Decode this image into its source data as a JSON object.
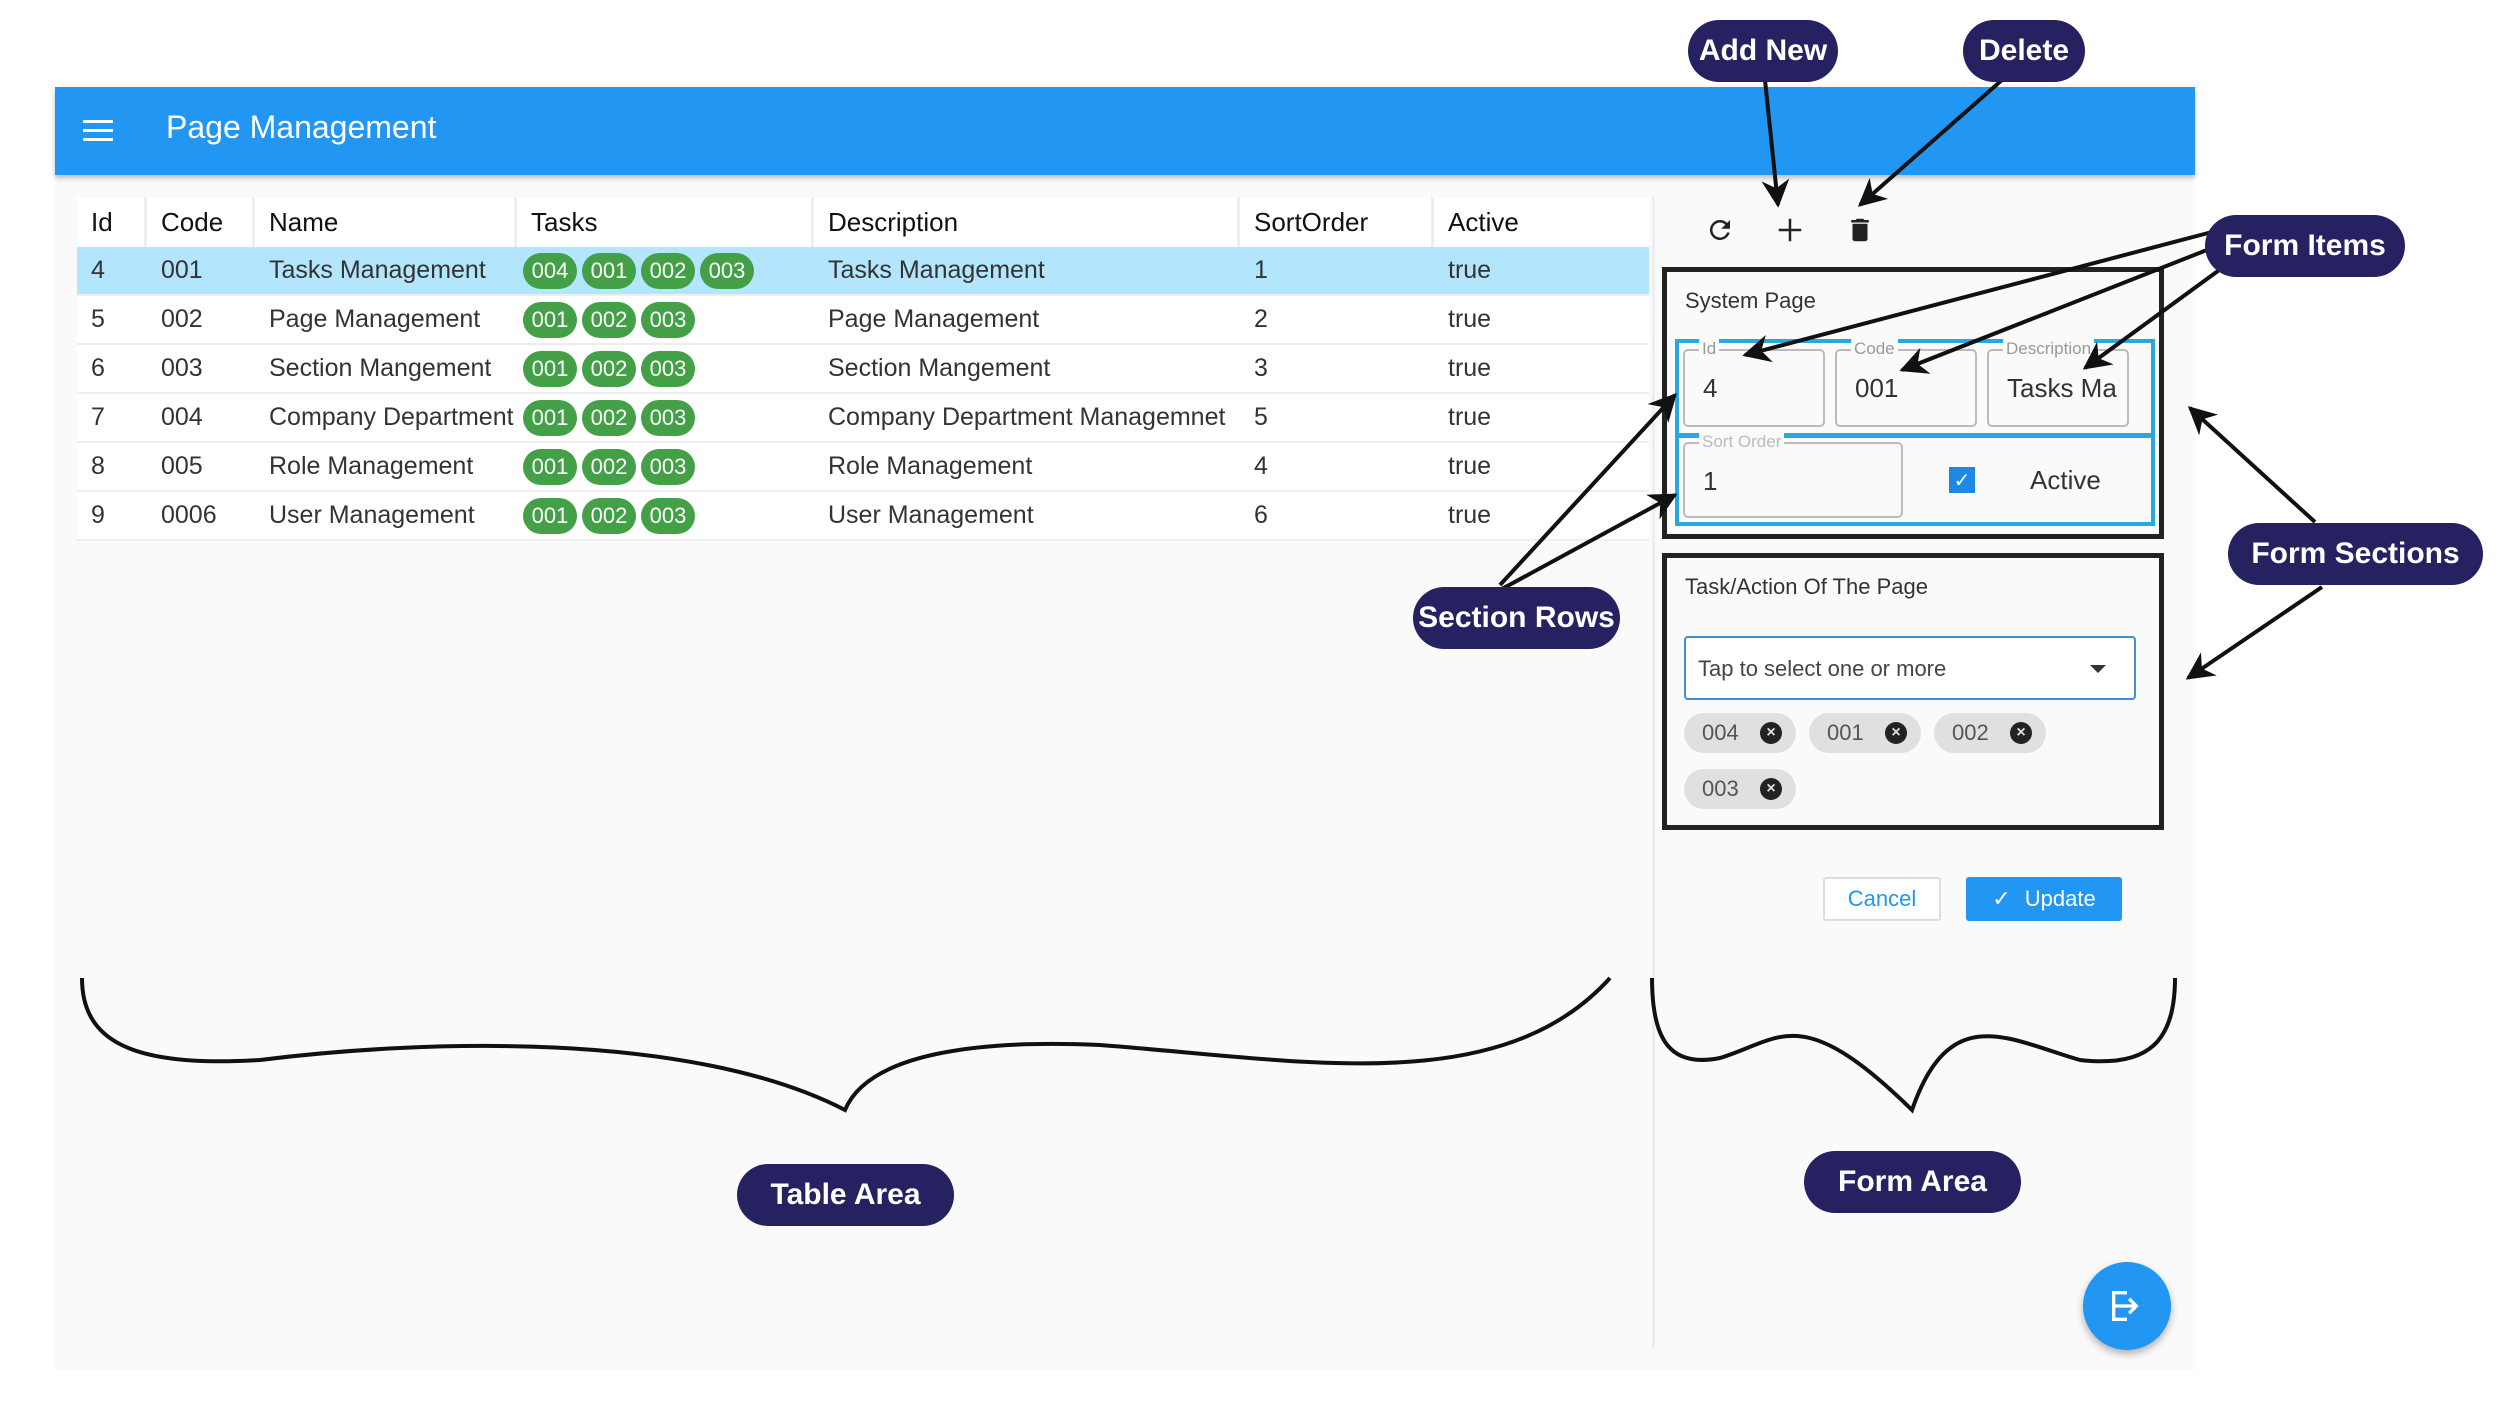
{
  "appbar": {
    "title": "Page Management",
    "menu_icon": "menu-icon"
  },
  "table": {
    "columns": [
      "Id",
      "Code",
      "Name",
      "Tasks",
      "Description",
      "SortOrder",
      "Active"
    ],
    "rows": [
      {
        "id": "4",
        "code": "001",
        "name": "Tasks Management",
        "tasks": [
          "004",
          "001",
          "002",
          "003"
        ],
        "description": "Tasks Management",
        "sort": "1",
        "active": "true",
        "selected": true
      },
      {
        "id": "5",
        "code": "002",
        "name": "Page Management",
        "tasks": [
          "001",
          "002",
          "003"
        ],
        "description": "Page Management",
        "sort": "2",
        "active": "true"
      },
      {
        "id": "6",
        "code": "003",
        "name": "Section Mangement",
        "tasks": [
          "001",
          "002",
          "003"
        ],
        "description": "Section Mangement",
        "sort": "3",
        "active": "true"
      },
      {
        "id": "7",
        "code": "004",
        "name": "Company Department",
        "tasks": [
          "001",
          "002",
          "003"
        ],
        "description": "Company Department Managemnet",
        "sort": "5",
        "active": "true"
      },
      {
        "id": "8",
        "code": "005",
        "name": "Role Management",
        "tasks": [
          "001",
          "002",
          "003"
        ],
        "description": "Role Management",
        "sort": "4",
        "active": "true"
      },
      {
        "id": "9",
        "code": "0006",
        "name": "User Management",
        "tasks": [
          "001",
          "002",
          "003"
        ],
        "description": "User Management",
        "sort": "6",
        "active": "true"
      }
    ]
  },
  "toolbar": {
    "refresh_icon": "refresh-icon",
    "add_icon": "add-icon",
    "delete_icon": "delete-icon"
  },
  "form": {
    "section1": {
      "title": "System Page",
      "id_label": "Id",
      "id_value": "4",
      "code_label": "Code",
      "code_value": "001",
      "description_label": "Description",
      "description_value": "Tasks Ma",
      "sort_label": "Sort Order",
      "sort_value": "1",
      "active_label": "Active",
      "active_checked": true
    },
    "section2": {
      "title": "Task/Action Of The Page",
      "select_placeholder": "Tap to select one or more",
      "tags": [
        "004",
        "001",
        "002",
        "003"
      ]
    },
    "cancel_label": "Cancel",
    "update_label": "Update"
  },
  "annotations": {
    "add_new": "Add New",
    "delete": "Delete",
    "form_items": "Form Items",
    "form_sections": "Form Sections",
    "section_rows": "Section Rows",
    "table_area": "Table Area",
    "form_area": "Form Area"
  },
  "colors": {
    "primary": "#2196f3",
    "chip_green": "#43a047",
    "selected_row": "#b3e5fc",
    "callout": "#262262"
  }
}
